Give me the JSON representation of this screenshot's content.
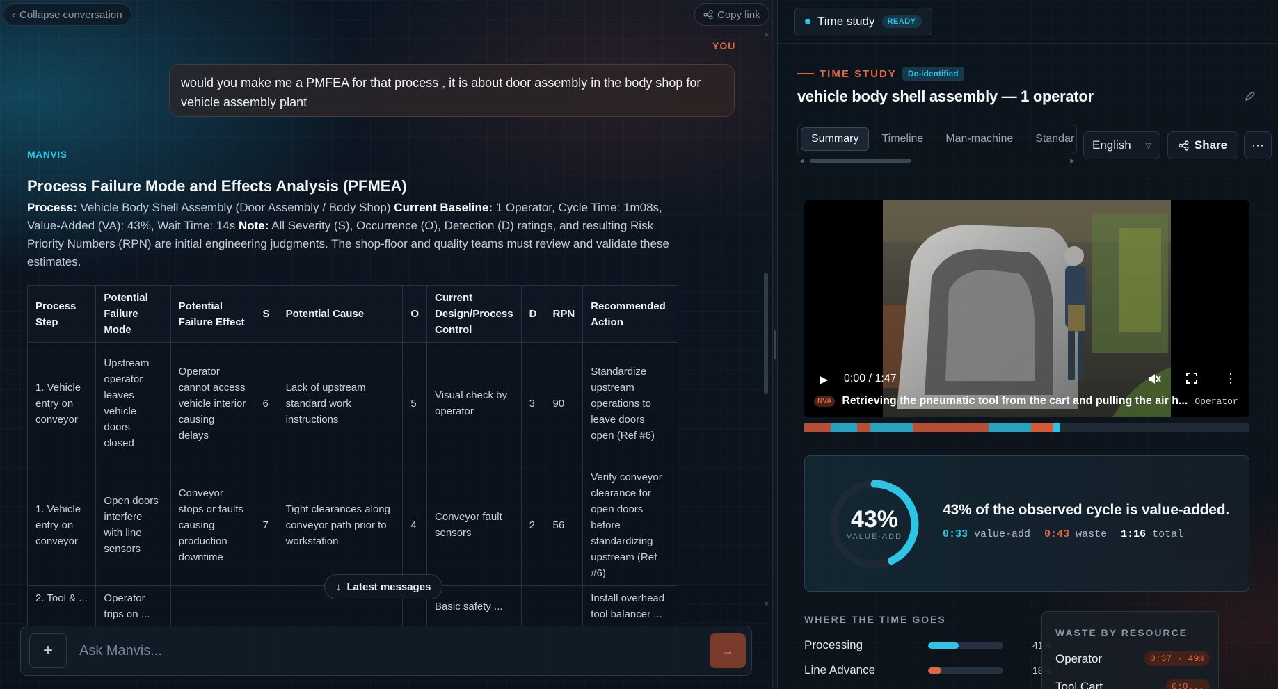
{
  "colors": {
    "accent_cyan": "#2ec4e6",
    "accent_orange": "#e0673f",
    "bg": "#0d1520"
  },
  "chat": {
    "collapse_label": "Collapse conversation",
    "copy_link_label": "Copy link",
    "you_label": "YOU",
    "user_message": "would you make me a PMFEA for that process , it is about door assembly in the body shop for vehicle assembly plant",
    "assistant_label": "MANVIS",
    "response_title": "Process Failure Mode and Effects Analysis (PFMEA)",
    "response_intro": {
      "process_label": "Process:",
      "process_text": " Vehicle Body Shell Assembly (Door Assembly / Body Shop) ",
      "baseline_label": "Current Baseline:",
      "baseline_text": " 1 Operator, Cycle Time: 1m08s, Value-Added (VA): 43%, Wait Time: 14s ",
      "note_label": "Note:",
      "note_text": " All Severity (S), Occurrence (O), Detection (D) ratings, and resulting Risk Priority Numbers (RPN) are initial engineering judgments. The shop-floor and quality teams must review and validate these estimates."
    },
    "table": {
      "headers": [
        "Process Step",
        "Potential Failure Mode",
        "Potential Failure Effect",
        "S",
        "Potential Cause",
        "O",
        "Current Design/Process Control",
        "D",
        "RPN",
        "Recommended Action"
      ],
      "rows": [
        [
          "1. Vehicle entry on conveyor",
          "Upstream operator leaves vehicle doors closed",
          "Operator cannot access vehicle interior causing delays",
          "6",
          "Lack of upstream standard work instructions",
          "5",
          "Visual check by operator",
          "3",
          "90",
          "Standardize upstream operations to leave doors open (Ref #6)"
        ],
        [
          "1. Vehicle entry on conveyor",
          "Open doors interfere with line sensors",
          "Conveyor stops or faults causing production downtime",
          "7",
          "Tight clearances along conveyor path prior to workstation",
          "4",
          "Conveyor fault sensors",
          "2",
          "56",
          "Verify conveyor clearance for open doors before standardizing upstream (Ref #6)"
        ],
        [
          "2. Tool & ...",
          "Operator trips on ...",
          "",
          "",
          "",
          "",
          "Basic safety ...",
          "",
          "",
          "Install overhead tool balancer ..."
        ]
      ]
    },
    "latest_label": "Latest messages",
    "ask_placeholder": "Ask Manvis...",
    "plus_glyph": "+",
    "send_glyph": "→"
  },
  "study": {
    "tab_label": "Time study",
    "tab_badge": "READY",
    "eyebrow": "TIME STUDY",
    "deid_badge": "De-identified",
    "title": "vehicle body shell assembly — 1 operator",
    "tabs": [
      "Summary",
      "Timeline",
      "Man-machine",
      "Standar"
    ],
    "active_tab": "Summary",
    "language": "English",
    "share_label": "Share",
    "video": {
      "time": "0:00 / 1:47",
      "caption_badge": "NVA",
      "caption": "Retrieving the pneumatic tool from the cart and pulling the air h...",
      "caption_role": "Operator"
    },
    "timeline_segments": [
      {
        "kind": "waste",
        "share": 0.059,
        "color": "#b4503a"
      },
      {
        "kind": "value",
        "share": 0.059,
        "color": "#2aa1bd"
      },
      {
        "kind": "waste",
        "share": 0.03,
        "color": "#b4503a"
      },
      {
        "kind": "value",
        "share": 0.095,
        "color": "#2aa1bd"
      },
      {
        "kind": "waste",
        "share": 0.17,
        "color": "#b4503a"
      },
      {
        "kind": "value",
        "share": 0.095,
        "color": "#2aa1bd"
      },
      {
        "kind": "waste",
        "share": 0.05,
        "color": "#d05a3a"
      },
      {
        "kind": "value",
        "share": 0.016,
        "color": "#2ec4e6"
      }
    ],
    "value_added": {
      "percent_value": 43,
      "percent": "43%",
      "sub": "VALUE-ADD",
      "headline": "43% of the observed cycle is value-added.",
      "va_time": "0:33",
      "va_label": "value-add",
      "waste_time": "0:43",
      "waste_label": "waste",
      "total_time": "1:16",
      "total_label": "total"
    },
    "where_time_goes": {
      "label": "WHERE THE TIME GOES",
      "items": [
        {
          "name": "Processing",
          "pct": "41%",
          "value": 0.41,
          "color": "#2ec4e6"
        },
        {
          "name": "Line Advance",
          "pct": "18%",
          "value": 0.18,
          "color": "#e0673f"
        }
      ]
    },
    "waste_by_resource": {
      "label": "WASTE BY RESOURCE",
      "items": [
        {
          "name": "Operator",
          "value": "0:37 · 49%"
        },
        {
          "name": "Tool Cart",
          "value": "0:0..."
        }
      ]
    }
  }
}
